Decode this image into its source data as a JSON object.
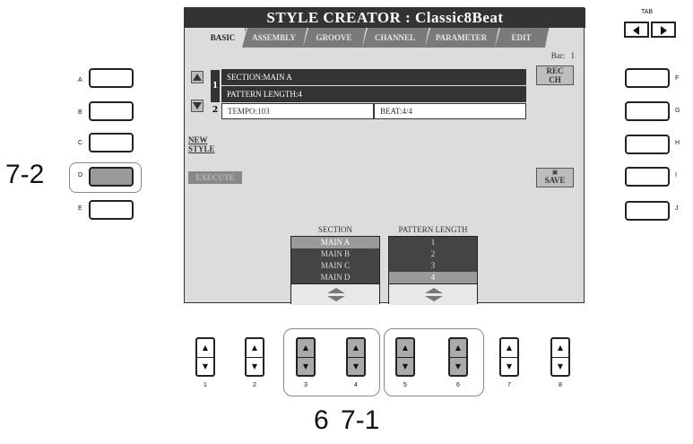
{
  "screen": {
    "title": "STYLE CREATOR : Classic8Beat",
    "tabs": [
      "BASIC",
      "ASSEMBLY",
      "GROOVE",
      "CHANNEL",
      "PARAMETER",
      "EDIT"
    ],
    "active_tab": "BASIC",
    "bar_label": "Bar:",
    "bar_value": "1",
    "rows": {
      "row1_num": "1",
      "section": "SECTION:MAIN A",
      "pattern_length": "PATTERN LENGTH:4",
      "row2_num": "2",
      "tempo": "TEMPO:103",
      "beat": "BEAT:4/4"
    },
    "rec_ch_label": "REC\nCH",
    "new_style_label": "NEW\nSTYLE",
    "execute_label": "EXECUTE",
    "save_label": "SAVE",
    "section_selector": {
      "title": "SECTION",
      "items": [
        "MAIN A",
        "MAIN B",
        "MAIN C",
        "MAIN D"
      ],
      "selected": "MAIN A"
    },
    "pattern_selector": {
      "title": "PATTERN LENGTH",
      "items": [
        "1",
        "2",
        "3",
        "4"
      ],
      "selected": "4"
    }
  },
  "tab_buttons": {
    "label": "TAB",
    "left_icon": "left-arrow-icon",
    "right_icon": "right-arrow-icon"
  },
  "left_buttons": [
    "A",
    "B",
    "C",
    "D",
    "E"
  ],
  "right_buttons": [
    "F",
    "G",
    "H",
    "I",
    "J"
  ],
  "bottom_buttons": [
    "1",
    "2",
    "3",
    "4",
    "5",
    "6",
    "7",
    "8"
  ],
  "callouts": {
    "left": "7-2",
    "bottom_a": "6",
    "bottom_b": "7-1"
  },
  "colors": {
    "lcd_bg": "#dcdcdc",
    "lcd_dark": "#333333",
    "pressed_button": "#9a9a9a"
  }
}
